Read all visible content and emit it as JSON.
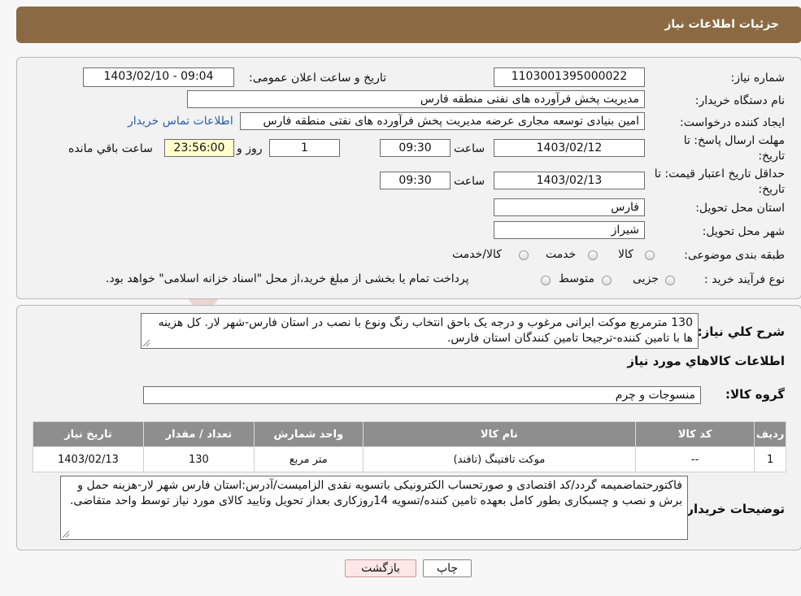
{
  "header": {
    "title": "جزئیات اطلاعات نیاز"
  },
  "form": {
    "need_number_label": "شماره نیاز:",
    "need_number": "1103001395000022",
    "announce_label": "تاریخ و ساعت اعلان عمومی:",
    "announce_value": "1403/02/10 - 09:04",
    "buyer_org_label": "نام دستگاه خریدار:",
    "buyer_org": "مدیریت پخش فرآورده های نفتی منطقه فارس",
    "requester_label": "ایجاد کننده درخواست:",
    "requester": "امین بنیادی توسعه مجاری عرضه مدیریت پخش فرآورده های نفتی منطقه فارس",
    "contact_link": "اطلاعات تماس خریدار",
    "deadline_label_line1": "مهلت ارسال پاسخ: تا",
    "deadline_label_line2": "تاریخ:",
    "deadline_date": "1403/02/12",
    "time_label": "ساعت",
    "deadline_time": "09:30",
    "days_value": "1",
    "days_label": "روز و",
    "remaining_time": "23:56:00",
    "remaining_label": "ساعت باقي مانده",
    "validity_label_line1": "حداقل تاریخ اعتبار قیمت: تا",
    "validity_label_line2": "تاریخ:",
    "validity_date": "1403/02/13",
    "validity_time": "09:30",
    "province_label": "استان محل تحویل:",
    "province": "فارس",
    "city_label": "شهر محل تحویل:",
    "city": "شیراز",
    "category_label": "طبقه بندی موضوعی:",
    "category_options": [
      "کالا",
      "خدمت",
      "کالا/خدمت"
    ],
    "process_label": "نوع فرآیند خرید :",
    "process_options": [
      "جزیی",
      "متوسط"
    ],
    "process_note": "پرداخت تمام یا بخشی از مبلغ خرید،از محل \"اسناد خزانه اسلامی\" خواهد بود."
  },
  "details": {
    "summary_label": "شرح کلي نياز:",
    "summary_text": "130 مترمربع موکت ایرانی مرغوب و درجه یک باحق انتخاب رنگ ونوع با نصب در استان فارس-شهر لار. کل هزینه ها با تامین کننده-ترجیحا تامین کنندگان استان فارس.",
    "items_heading": "اطلاعات کالاهاي مورد نياز",
    "group_label": "گروه کالا:",
    "group_value": "منسوجات و چرم",
    "table": {
      "headers": [
        "رديف",
        "کد کالا",
        "نام کالا",
        "واحد شمارش",
        "تعداد / مقدار",
        "تاريخ نياز"
      ],
      "rows": [
        [
          "1",
          "--",
          "موکت تافتینگ (تافند)",
          "متر مربع",
          "130",
          "1403/02/13"
        ]
      ]
    },
    "buyer_notes_label": "توضیحات خریدار:",
    "buyer_notes": "فاکتورحتماضمیمه گردد/کد اقتصادی و صورتحساب الکترونیکی باتسویه نقدی الزامیست/آدرس:استان فارس شهر لار-هزینه حمل و برش و نصب و چسبکاری بطور کامل بعهده تامین کننده/تسویه 14روزکاری بعداز تحویل وتایید کالای مورد نیاز توسط واحد متقاضی."
  },
  "buttons": {
    "print": "چاپ",
    "back": "بازگشت"
  },
  "watermark_text": "AriaTender.neT",
  "colors": {
    "header": "#8b6a43",
    "table_header": "#8e8e8e",
    "link": "#2a5db0",
    "back_button": "#fde6e6"
  }
}
